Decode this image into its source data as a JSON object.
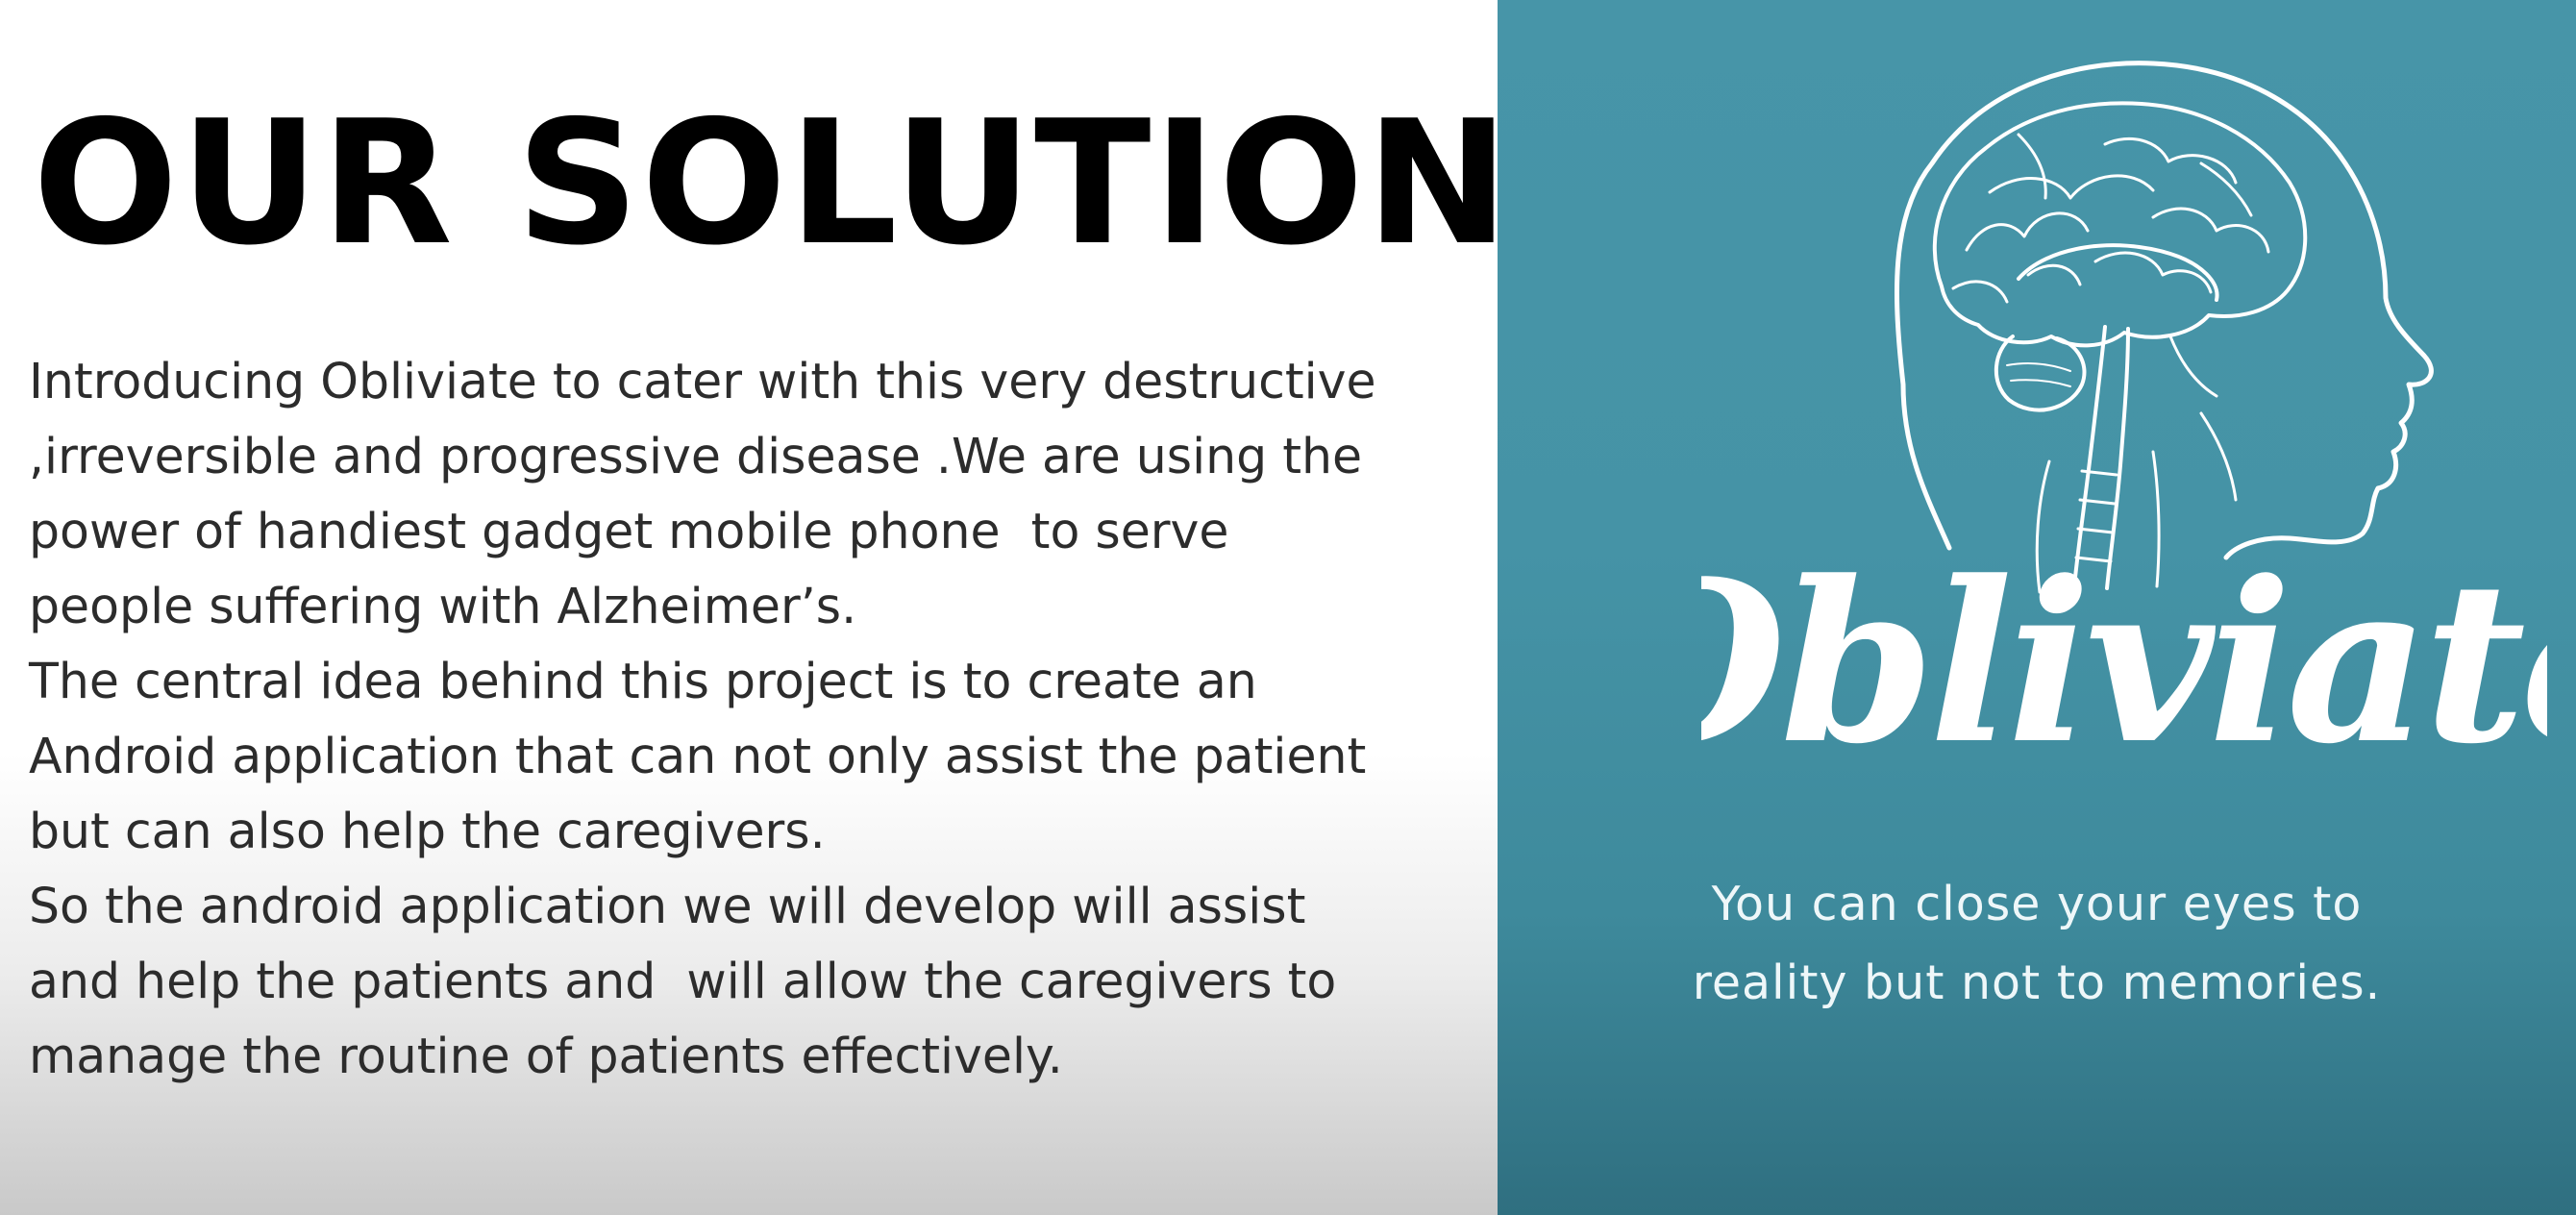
{
  "slide": {
    "title": "OUR SOLUTION",
    "body_lines": [
      "Introducing Obliviate to cater with this very destructive",
      ",irreversible and progressive disease .We are using the",
      "power of handiest gadget mobile phone  to serve",
      "people suffering with Alzheimer’s.",
      "The central idea behind this project is to create an",
      "Android application that can not only assist the patient",
      "but can also help the caregivers.",
      "So the android application we will develop will assist",
      "and help the patients and  will allow the caregivers to",
      "manage the routine of patients effectively."
    ],
    "logo": {
      "wordmark": "Obliviate",
      "icon": "brain-head-profile-icon"
    },
    "tagline_lines": [
      "You can close your eyes to",
      "reality but not to memories."
    ],
    "colors": {
      "left_background": "#ffffff",
      "right_background": "#4795a8",
      "title": "#000000",
      "body_text": "#2c2c2c",
      "logo": "#ffffff"
    }
  }
}
